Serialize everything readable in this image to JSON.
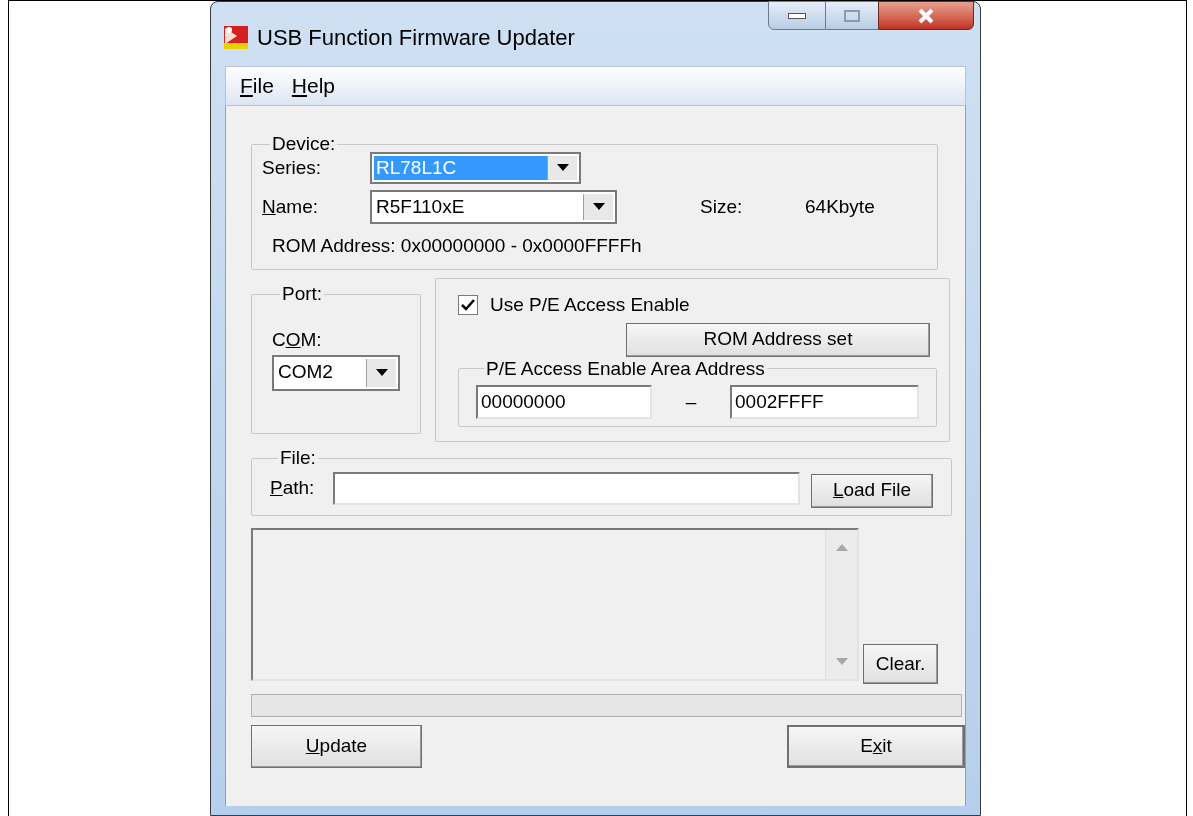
{
  "window": {
    "title": "USB Function Firmware Updater"
  },
  "menu": [
    {
      "key": "F",
      "after": "ile"
    },
    {
      "key": "H",
      "after": "elp"
    }
  ],
  "device": {
    "legend": "Device:",
    "series": {
      "label": "Series:",
      "value": "RL78L1C",
      "focused": true
    },
    "name": {
      "label": {
        "key": "N",
        "after": "ame:"
      },
      "value": "R5F110xE",
      "focused": false
    },
    "size_label": "Size:",
    "size_value": "64Kbyte",
    "rom_address": "ROM Address: 0x00000000 - 0x0000FFFFh"
  },
  "port": {
    "legend": "Port:",
    "com_label": {
      "before": "C",
      "key": "O",
      "after": "M:"
    },
    "com_value": "COM2"
  },
  "access": {
    "checkbox": {
      "label": "Use P/E Access Enable",
      "checked": true
    },
    "rom_button": "ROM Address set",
    "area_legend": "P/E Access Enable Area Address",
    "from": "00000000",
    "separator": "–",
    "to": "0002FFFF"
  },
  "file": {
    "legend": "File:",
    "path_label": {
      "key": "P",
      "after": "ath:"
    },
    "load_button": {
      "key": "L",
      "after": "oad File"
    }
  },
  "clear_button": "Clear.",
  "progress": {
    "level": 0
  },
  "buttons": [
    {
      "key": "U",
      "after": "pdate"
    },
    {
      "before": "E",
      "key": "x",
      "after": "it"
    }
  ]
}
